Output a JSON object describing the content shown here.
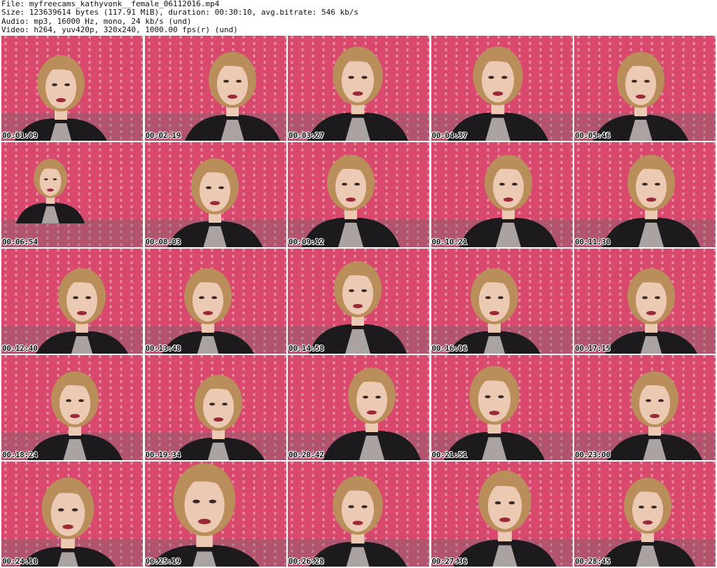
{
  "header": {
    "file": "File: myfreecams_kathyvonk__female_06112016.mp4",
    "size": "Size: 123639614 bytes (117.91 MiB), duration: 00:30:10, avg.bitrate: 546 kb/s",
    "audio": "Audio: mp3, 16000 Hz, mono, 24 kb/s (und)",
    "video": "Video: h264, yuv420p, 320x240, 1000.00 fps(r) (und)"
  },
  "thumbnails": [
    {
      "time": "00:01:09"
    },
    {
      "time": "00:02:19"
    },
    {
      "time": "00:03:27"
    },
    {
      "time": "00:04:37"
    },
    {
      "time": "00:05:46"
    },
    {
      "time": "00:06:54"
    },
    {
      "time": "00:08:03"
    },
    {
      "time": "00:09:12"
    },
    {
      "time": "00:10:21"
    },
    {
      "time": "00:11:30"
    },
    {
      "time": "00:12:40"
    },
    {
      "time": "00:13:48"
    },
    {
      "time": "00:14:58"
    },
    {
      "time": "00:16:06"
    },
    {
      "time": "00:17:15"
    },
    {
      "time": "00:18:24"
    },
    {
      "time": "00:19:34"
    },
    {
      "time": "00:20:42"
    },
    {
      "time": "00:21:51"
    },
    {
      "time": "00:23:00"
    },
    {
      "time": "00:24:10"
    },
    {
      "time": "00:25:19"
    },
    {
      "time": "00:26:28"
    },
    {
      "time": "00:27:36"
    },
    {
      "time": "00:28:45"
    }
  ],
  "colors": {
    "wall": "#d9496d",
    "wall_pattern": "#f3c9d2",
    "hair": "#b98e5a",
    "skin": "#ecc9b3",
    "dress": "#1c1a1d",
    "lace": "#cfc6c4",
    "sofa": "#6a6a6f"
  }
}
